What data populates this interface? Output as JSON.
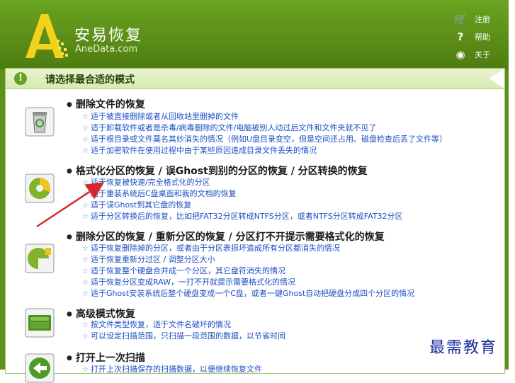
{
  "app": {
    "name": "安易恢复",
    "url": "AneData.com"
  },
  "topmenu": [
    {
      "icon": "cart-icon",
      "glyph": "🛒",
      "label": "注册"
    },
    {
      "icon": "question-icon",
      "glyph": "?",
      "label": "帮助"
    },
    {
      "icon": "info-icon",
      "glyph": "◉",
      "label": "关于"
    }
  ],
  "bar": {
    "title": "请选择最合适的模式"
  },
  "sections": [
    {
      "title": "删除文件的恢复",
      "items": [
        "适于被直接删除或者从回收站里删掉的文件",
        "适于卸载软件或者是杀毒/病毒删除的文件/电脑被别人动过后文件和文件夹就不见了",
        "适于根目录或文件莫名其妙消失的情况（例如U盘目录变空，但是空间还占用、磁盘检查后丢了文件等）",
        "适于加密软件在使用过程中由于某些原因造成目录文件丢失的情况"
      ]
    },
    {
      "title": "格式化分区的恢复 / 误Ghost到别的分区的恢复 / 分区转换的恢复",
      "items": [
        "适于恢复被快速/完全格式化的分区",
        "适于重装系统后C盘桌面和我的文档的恢复",
        "适于误Ghost到其它盘的恢复",
        "适于分区转换后的恢复，比如把FAT32分区转成NTFS分区，或者NTFS分区转成FAT32分区"
      ]
    },
    {
      "title": "删除分区的恢复 / 重新分区的恢复 / 分区打不开提示需要格式化的恢复",
      "items": [
        "适于恢复删除掉的分区，或者由于分区表损坏造成所有分区都消失的情况",
        "适于恢复重新分过区 / 调整分区大小",
        "适于恢复整个硬盘合并成一个分区，其它盘符消失的情况",
        "适于恢复分区变成RAW，一打不开就提示需要格式化的情况",
        "适于Ghost安装系统后整个硬盘变成一个C盘，或者一键Ghost自动把硬盘分成四个分区的情况"
      ]
    },
    {
      "title": "高级模式恢复",
      "items": [
        "按文件类型恢复，适于文件名破坏的情况",
        "可以设定扫描范围，只扫描一段范围的数据，以节省时间"
      ]
    },
    {
      "title": "打开上一次扫描",
      "items": [
        "打开上次扫描保存的扫描数据，以便继续恢复文件"
      ]
    }
  ],
  "watermark": "最需教育",
  "colors": {
    "frame": "#5f8f1c",
    "link": "#1a4ec2",
    "bar": "#d7eab1",
    "arrow": "#d8262b"
  }
}
